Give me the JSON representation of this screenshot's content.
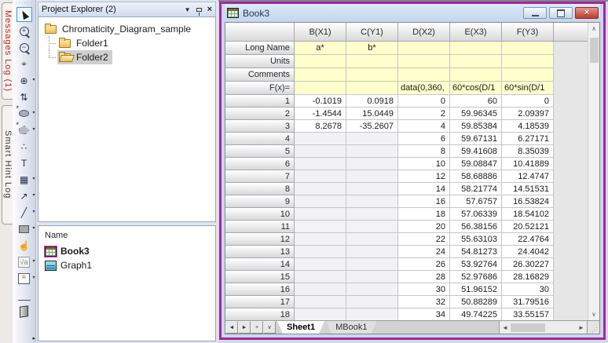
{
  "colors": {
    "window_border": "#a327a0",
    "titlebar_bg": "#cfe0f2",
    "header_row_yellow": "#ffffcc",
    "close_button_red": "#c23b2e",
    "messages_log_red": "#cc1f1f",
    "tool_selected_border": "#3c97e0"
  },
  "side_tabs": [
    {
      "label": "Messages Log (1)"
    },
    {
      "label": "Smart Hint Log"
    }
  ],
  "toolbar": {
    "tools": [
      {
        "name": "pointer-tool",
        "glyph": "cursor",
        "selected": true
      },
      {
        "name": "zoom-in-tool",
        "glyph": "zoom-in"
      },
      {
        "name": "zoom-out-tool",
        "glyph": "zoom-out"
      },
      {
        "name": "screen-reader-tool",
        "glyph": "⌖"
      },
      {
        "name": "data-reader-tool",
        "glyph": "⊕",
        "dropdown": true
      },
      {
        "name": "data-selector-tool",
        "glyph": "⇅"
      },
      {
        "name": "mask-ellipse-tool",
        "glyph": "ellipse",
        "dropdown": true
      },
      {
        "name": "mask-region-tool",
        "glyph": "region",
        "dropdown": true
      },
      {
        "name": "draw-data-tool",
        "glyph": "∴"
      },
      {
        "name": "text-tool",
        "glyph": "T"
      },
      {
        "name": "annotation-tool",
        "glyph": "▦",
        "dropdown": true
      },
      {
        "name": "arrow-tool",
        "glyph": "↗",
        "dropdown": true
      },
      {
        "name": "line-tool",
        "glyph": "╱",
        "dropdown": true
      },
      {
        "name": "rectangle-tool",
        "glyph": "rect",
        "dropdown": true
      },
      {
        "name": "pan-tool",
        "glyph": "☝"
      },
      {
        "name": "formula-tool",
        "glyph": "formula",
        "dropdown": true
      },
      {
        "name": "graph-preview-tool",
        "glyph": "graph",
        "dropdown": true
      },
      {
        "name": "axis-pan-tool",
        "glyph": "hand-axis"
      },
      {
        "name": "exit-tool",
        "glyph": "door"
      }
    ]
  },
  "project_explorer": {
    "title": "Project Explorer (2)",
    "tree": [
      {
        "label": "Chromaticity_Diagram_sample",
        "icon": "folder-closed",
        "level": 0
      },
      {
        "label": "Folder1",
        "icon": "folder-closed",
        "level": 1
      },
      {
        "label": "Folder2",
        "icon": "folder-open",
        "level": 1,
        "selected": true
      }
    ]
  },
  "name_panel": {
    "header": "Name",
    "items": [
      {
        "label": "Book3",
        "icon": "worksheet",
        "bold": true,
        "active": true
      },
      {
        "label": "Graph1",
        "icon": "graph"
      }
    ]
  },
  "book_window": {
    "title": "Book3",
    "window_buttons": [
      "minimize",
      "restore",
      "close"
    ],
    "close_glyph": "×",
    "tab_nav": [
      "◄",
      "►",
      "+",
      "∨"
    ],
    "sheet_tabs": [
      {
        "label": "Sheet1",
        "active": true
      },
      {
        "label": "MBook1"
      }
    ]
  },
  "scrollbars": {
    "up": "∧",
    "down": "∨",
    "left": "◄",
    "right": "►"
  },
  "table": {
    "columns": [
      "B(X1)",
      "C(Y1)",
      "D(X2)",
      "E(X3)",
      "F(Y3)"
    ],
    "label_rows": [
      {
        "label": "Long Name",
        "align": "center",
        "cells": [
          "a*",
          "b*",
          "",
          "",
          ""
        ]
      },
      {
        "label": "Units",
        "align": "center",
        "cells": [
          "",
          "",
          "",
          "",
          ""
        ]
      },
      {
        "label": "Comments",
        "align": "center",
        "cells": [
          "",
          "",
          "",
          "",
          ""
        ]
      },
      {
        "label": "F(x)=",
        "align": "left",
        "cells": [
          "",
          "",
          "data(0,360,",
          "60*cos(D/1",
          "60*sin(D/1"
        ]
      }
    ],
    "rows": [
      {
        "n": "1",
        "cells": [
          "-0.1019",
          "0.0918",
          "0",
          "60",
          "0"
        ]
      },
      {
        "n": "2",
        "cells": [
          "-1.4544",
          "15.0449",
          "2",
          "59.96345",
          "2.09397"
        ]
      },
      {
        "n": "3",
        "cells": [
          "8.2678",
          "-35.2607",
          "4",
          "59.85384",
          "4.18539"
        ]
      },
      {
        "n": "4",
        "cells": [
          null,
          null,
          "6",
          "59.67131",
          "6.27171"
        ]
      },
      {
        "n": "5",
        "cells": [
          null,
          null,
          "8",
          "59.41608",
          "8.35039"
        ]
      },
      {
        "n": "6",
        "cells": [
          null,
          null,
          "10",
          "59.08847",
          "10.41889"
        ]
      },
      {
        "n": "7",
        "cells": [
          null,
          null,
          "12",
          "58.68886",
          "12.4747"
        ]
      },
      {
        "n": "8",
        "cells": [
          null,
          null,
          "14",
          "58.21774",
          "14.51531"
        ]
      },
      {
        "n": "9",
        "cells": [
          null,
          null,
          "16",
          "57.6757",
          "16.53824"
        ]
      },
      {
        "n": "10",
        "cells": [
          null,
          null,
          "18",
          "57.06339",
          "18.54102"
        ]
      },
      {
        "n": "11",
        "cells": [
          null,
          null,
          "20",
          "56.38156",
          "20.52121"
        ]
      },
      {
        "n": "12",
        "cells": [
          null,
          null,
          "22",
          "55.63103",
          "22.4764"
        ]
      },
      {
        "n": "13",
        "cells": [
          null,
          null,
          "24",
          "54.81273",
          "24.4042"
        ]
      },
      {
        "n": "14",
        "cells": [
          null,
          null,
          "26",
          "53.92764",
          "26.30227"
        ]
      },
      {
        "n": "15",
        "cells": [
          null,
          null,
          "28",
          "52.97686",
          "28.16829"
        ]
      },
      {
        "n": "16",
        "cells": [
          null,
          null,
          "30",
          "51.96152",
          "30"
        ]
      },
      {
        "n": "17",
        "cells": [
          null,
          null,
          "32",
          "50.88289",
          "31.79516"
        ]
      },
      {
        "n": "18",
        "cells": [
          null,
          null,
          "34",
          "49.74225",
          "33.55157"
        ]
      }
    ]
  }
}
